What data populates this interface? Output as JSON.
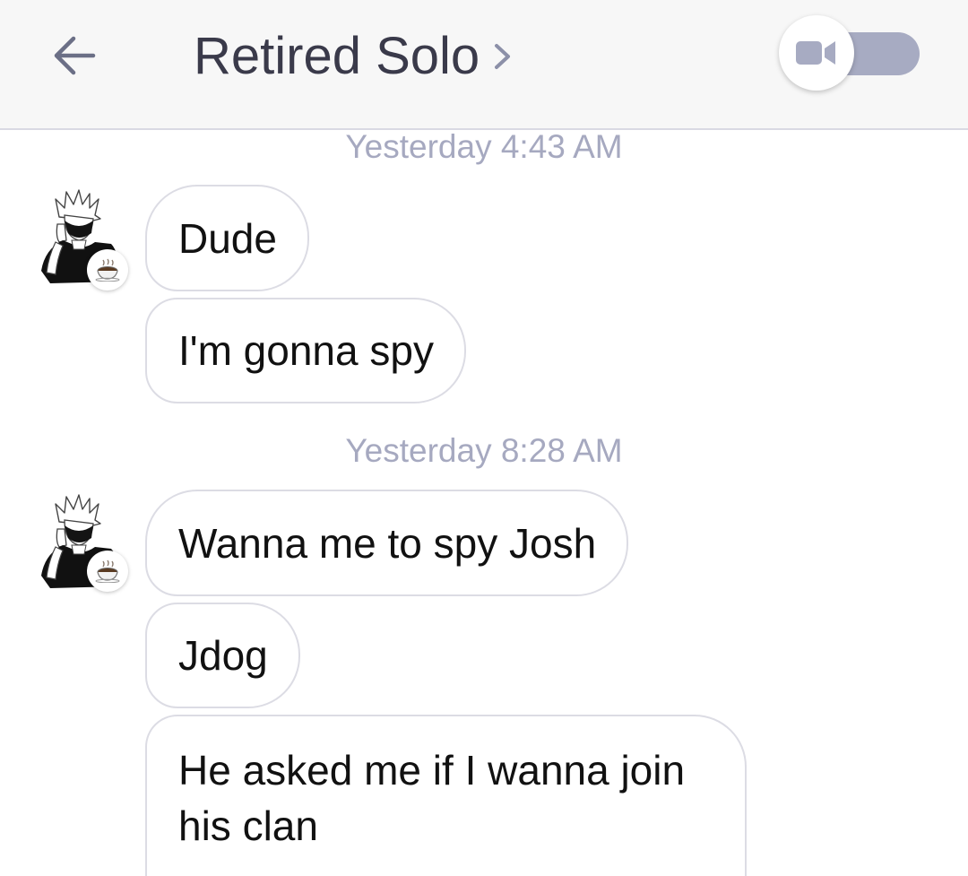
{
  "header": {
    "title": "Retired Solo",
    "back_icon": "back-arrow-icon",
    "chevron_icon": "chevron-right-icon",
    "video_icon": "video-camera-icon",
    "video_toggle_state": "off"
  },
  "colors": {
    "header_bg": "#f7f7f7",
    "title": "#3a3a4a",
    "timestamp": "#a6a9c0",
    "toggle_track": "#a7abc2",
    "bubble_border": "#dcdce4",
    "message_text": "#111111"
  },
  "conversation": {
    "groups": [
      {
        "timestamp": "Yesterday 4:43 AM",
        "messages": [
          "Dude",
          "I'm gonna spy"
        ]
      },
      {
        "timestamp": "Yesterday 8:28 AM",
        "messages": [
          "Wanna me to spy Josh",
          "Jdog",
          "He asked me if I wanna join his clan"
        ]
      }
    ]
  }
}
